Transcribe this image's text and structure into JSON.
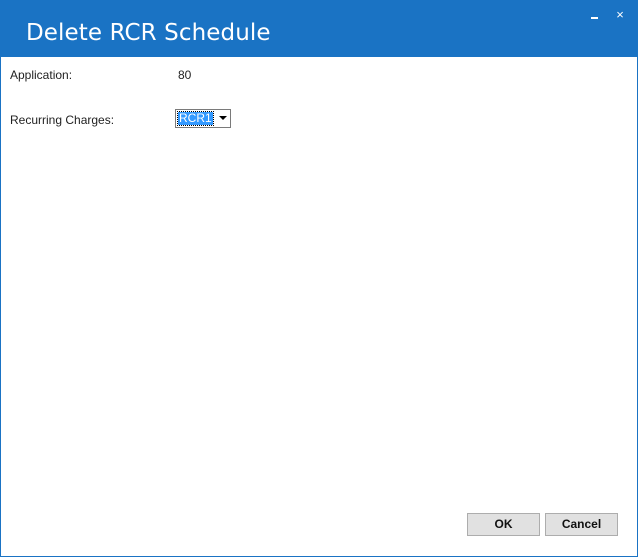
{
  "window": {
    "title": "Delete RCR Schedule",
    "minimize_glyph": "_",
    "close_glyph": "×"
  },
  "form": {
    "application_label": "Application:",
    "application_value": "80",
    "recurring_charges_label": "Recurring Charges:",
    "recurring_charges_selected": "RCR1"
  },
  "footer": {
    "ok_label": "OK",
    "cancel_label": "Cancel"
  },
  "colors": {
    "titlebar": "#1a73c4",
    "selection": "#3399ff"
  }
}
